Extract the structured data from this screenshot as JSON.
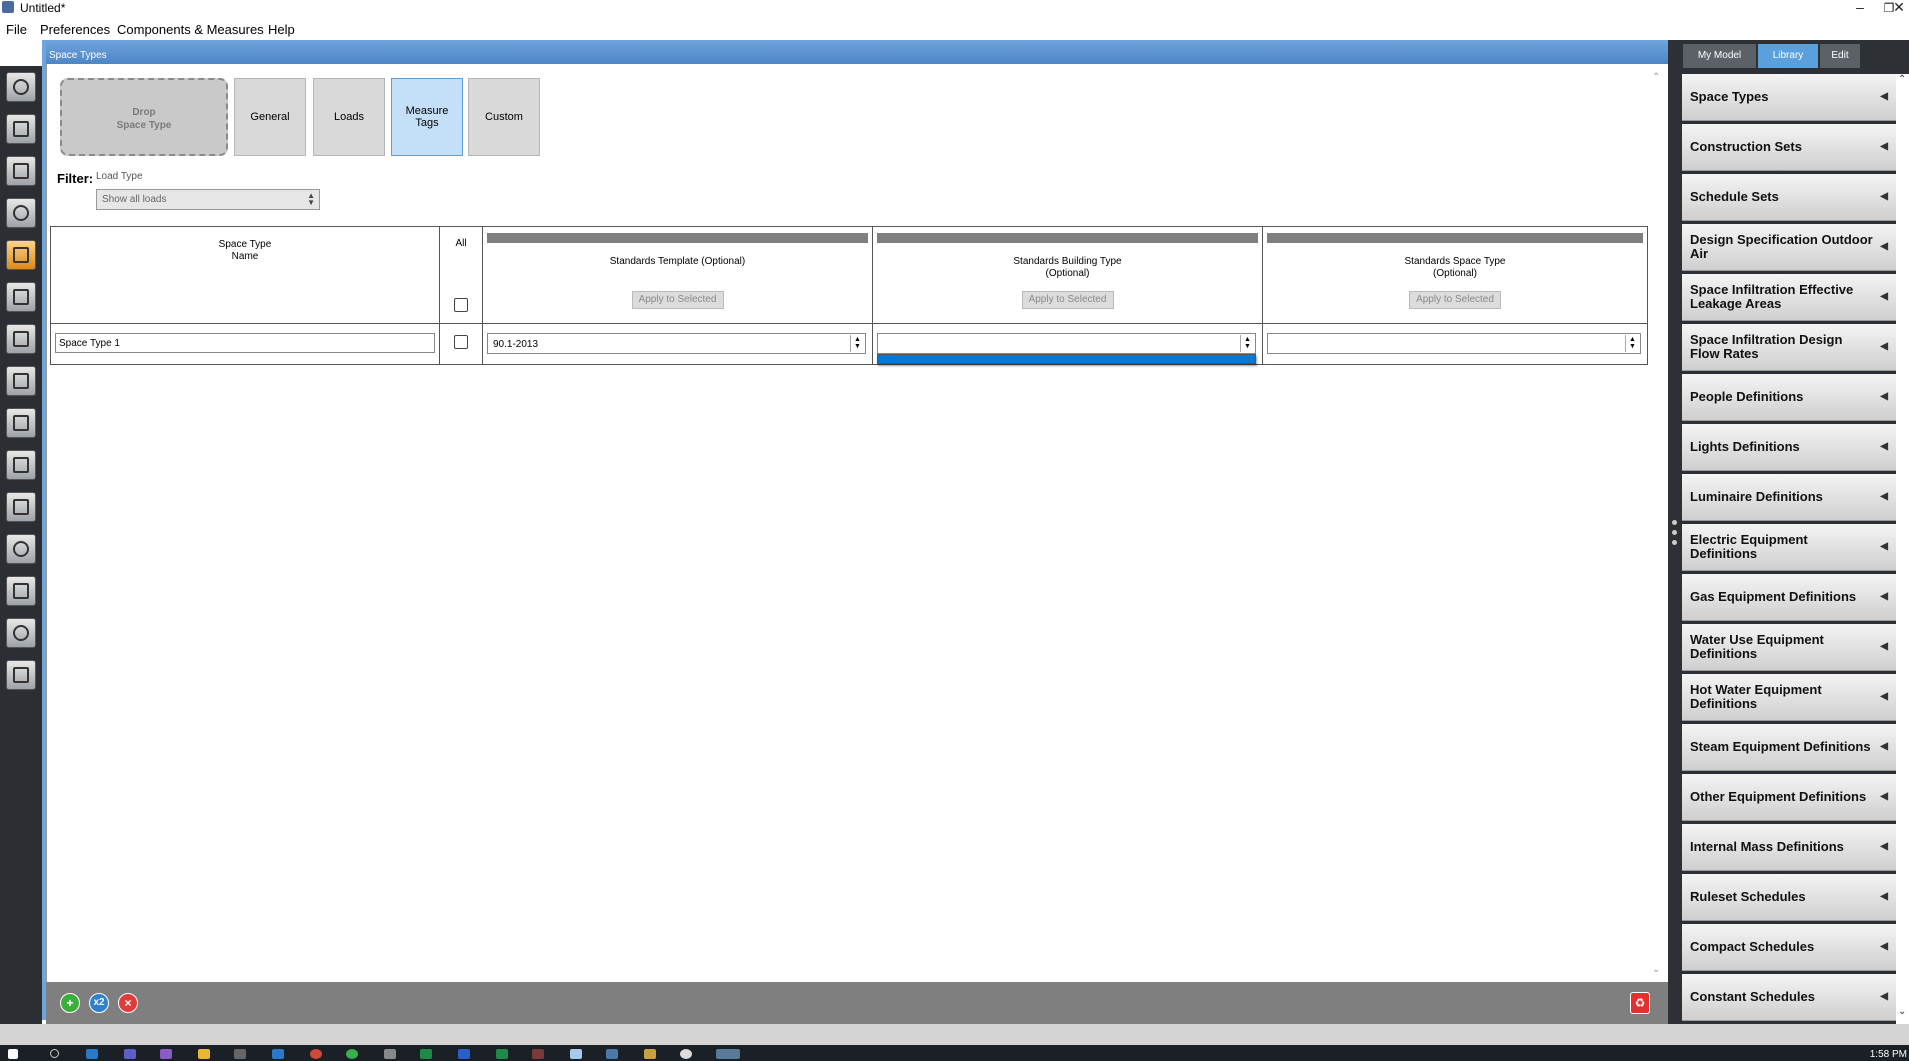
{
  "window": {
    "title": "Untitled*"
  },
  "menu": [
    "File",
    "Preferences",
    "Components & Measures",
    "Help"
  ],
  "main": {
    "header_title": "Space Types",
    "drop_tile": {
      "line1": "Drop",
      "line2": "Space Type"
    },
    "tabs": [
      {
        "label": "General",
        "active": false
      },
      {
        "label": "Loads",
        "active": false
      },
      {
        "label": "Measure Tags",
        "active": true
      },
      {
        "label": "Custom",
        "active": false
      }
    ],
    "filter": {
      "label": "Filter:",
      "sublabel": "Load Type",
      "selected": "Show all loads"
    },
    "grid": {
      "columns": {
        "name": {
          "line1": "Space Type",
          "line2": "Name"
        },
        "all": "All",
        "standards_template": {
          "line1": "Standards Template (Optional)",
          "button": "Apply to Selected"
        },
        "standards_building_type": {
          "line1": "Standards Building Type",
          "line2": "(Optional)",
          "button": "Apply to Selected"
        },
        "standards_space_type": {
          "line1": "Standards Space Type",
          "line2": "(Optional)",
          "button": "Apply to Selected"
        }
      },
      "rows": [
        {
          "name": "Space Type 1",
          "selected": false,
          "standards_template": "90.1-2013",
          "standards_building_type": "",
          "standards_space_type": ""
        }
      ]
    }
  },
  "right_panel": {
    "tabs": [
      {
        "label": "My Model",
        "active": false
      },
      {
        "label": "Library",
        "active": true
      },
      {
        "label": "Edit",
        "active": false
      }
    ],
    "items": [
      "Space Types",
      "Construction Sets",
      "Schedule Sets",
      "Design Specification Outdoor Air",
      "Space Infiltration Effective Leakage Areas",
      "Space Infiltration Design Flow Rates",
      "People Definitions",
      "Lights Definitions",
      "Luminaire Definitions",
      "Electric Equipment Definitions",
      "Gas Equipment Definitions",
      "Water Use Equipment Definitions",
      "Hot Water Equipment Definitions",
      "Steam Equipment Definitions",
      "Other Equipment Definitions",
      "Internal Mass Definitions",
      "Ruleset Schedules",
      "Compact Schedules",
      "Constant Schedules"
    ]
  },
  "bottom": {
    "copy_label": "x2"
  },
  "taskbar": {
    "clock": "1:58 PM"
  },
  "colors": {
    "accent": "#5aa0dc",
    "header_blue": "#4d86c6",
    "dropdown_selection": "#0078d7"
  }
}
